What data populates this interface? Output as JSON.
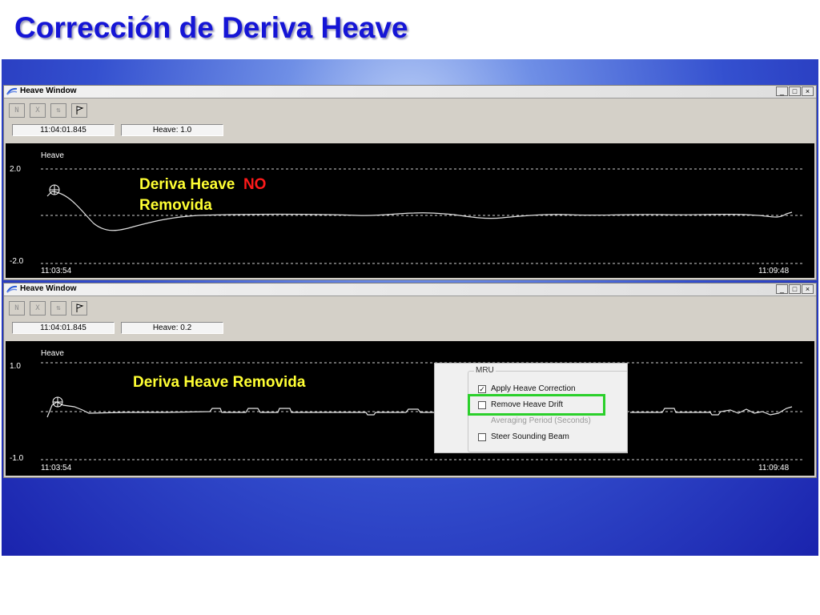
{
  "slide": {
    "title": "Corrección de Deriva Heave"
  },
  "windows": [
    {
      "title": "Heave Window",
      "controls": [
        "_",
        "□",
        "×"
      ],
      "toolbar": [
        "N",
        "X",
        "⇅",
        "flag-icon"
      ],
      "time_field": "11:04:01.845",
      "heave_field": "Heave: 1.0",
      "plot": {
        "label": "Heave",
        "y_max": "2.0",
        "y_min": "-2.0",
        "x_start": "11:03:54",
        "x_end": "11:09:48"
      }
    },
    {
      "title": "Heave Window",
      "controls": [
        "_",
        "□",
        "×"
      ],
      "toolbar": [
        "N",
        "X",
        "⇅",
        "flag-icon"
      ],
      "time_field": "11:04:01.845",
      "heave_field": "Heave: 0.2",
      "plot": {
        "label": "Heave",
        "y_max": "1.0",
        "y_min": "-1.0",
        "x_start": "11:03:54",
        "x_end": "11:09:48"
      }
    }
  ],
  "annotations": {
    "not_removed_line1": "Deriva Heave",
    "not_removed_no": "NO",
    "not_removed_line2": "Removida",
    "removed": "Deriva Heave Removida"
  },
  "mru_panel": {
    "group_title": "MRU",
    "apply_heave_correction": {
      "label": "Apply Heave Correction",
      "checked": true
    },
    "remove_heave_drift": {
      "label": "Remove Heave Drift",
      "checked": false
    },
    "averaging_period": "Averaging Period (Seconds)",
    "steer_sounding_beam": {
      "label": "Steer Sounding Beam",
      "checked": false
    },
    "highlight_color": "#2bd02b"
  }
}
